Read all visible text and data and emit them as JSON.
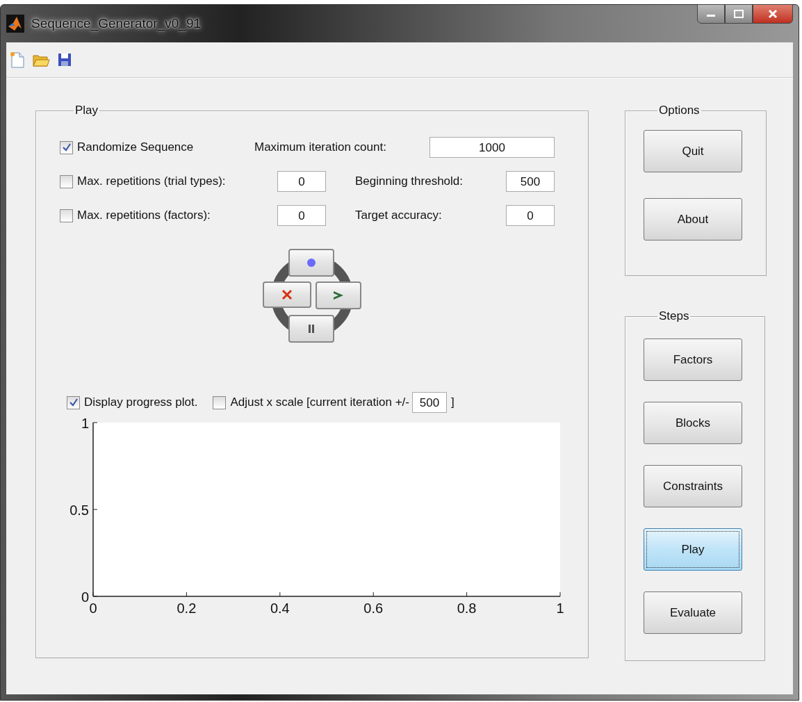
{
  "window": {
    "title": "Sequence_Generator_v0_91"
  },
  "play_panel": {
    "title": "Play",
    "settings": [
      {
        "kind": "check_field",
        "label": "Randomize Sequence",
        "checked": true,
        "field_label": "Maximum iteration count:",
        "value": "1000"
      },
      {
        "kind": "check_pair",
        "label": "Max. repetitions (trial types):",
        "checked": false,
        "value": "0",
        "field_label": "Beginning threshold:",
        "field_value": "500"
      },
      {
        "kind": "check_pair",
        "label": "Max. repetitions (factors):",
        "checked": false,
        "value": "0",
        "field_label": "Target accuracy:",
        "field_value": "0"
      }
    ],
    "plot_options": [
      {
        "label": "Display progress plot.",
        "checked": true
      },
      {
        "label": "Adjust x scale [current iteration +/-",
        "checked": false,
        "value": "500",
        "suffix": "]"
      }
    ],
    "chart_data": {
      "type": "line",
      "xlim": [
        0,
        1
      ],
      "ylim": [
        0,
        1
      ],
      "xticks": [
        {
          "value": 0,
          "label": "0"
        },
        {
          "value": 0.2,
          "label": "0.2"
        },
        {
          "value": 0.4,
          "label": "0.4"
        },
        {
          "value": 0.6,
          "label": "0.6"
        },
        {
          "value": 0.8,
          "label": "0.8"
        },
        {
          "value": 1,
          "label": "1"
        }
      ],
      "yticks": [
        {
          "value": 0,
          "label": "0"
        },
        {
          "value": 0.5,
          "label": "0.5"
        },
        {
          "value": 1,
          "label": "1"
        }
      ]
    }
  },
  "options_panel": {
    "title": "Options",
    "buttons": [
      {
        "label": "Quit",
        "selected": false
      },
      {
        "label": "About",
        "selected": false
      }
    ]
  },
  "steps_panel": {
    "title": "Steps",
    "buttons": [
      {
        "label": "Factors",
        "selected": false
      },
      {
        "label": "Blocks",
        "selected": false
      },
      {
        "label": "Constraints",
        "selected": false
      },
      {
        "label": "Play",
        "selected": true
      },
      {
        "label": "Evaluate",
        "selected": false
      }
    ]
  }
}
